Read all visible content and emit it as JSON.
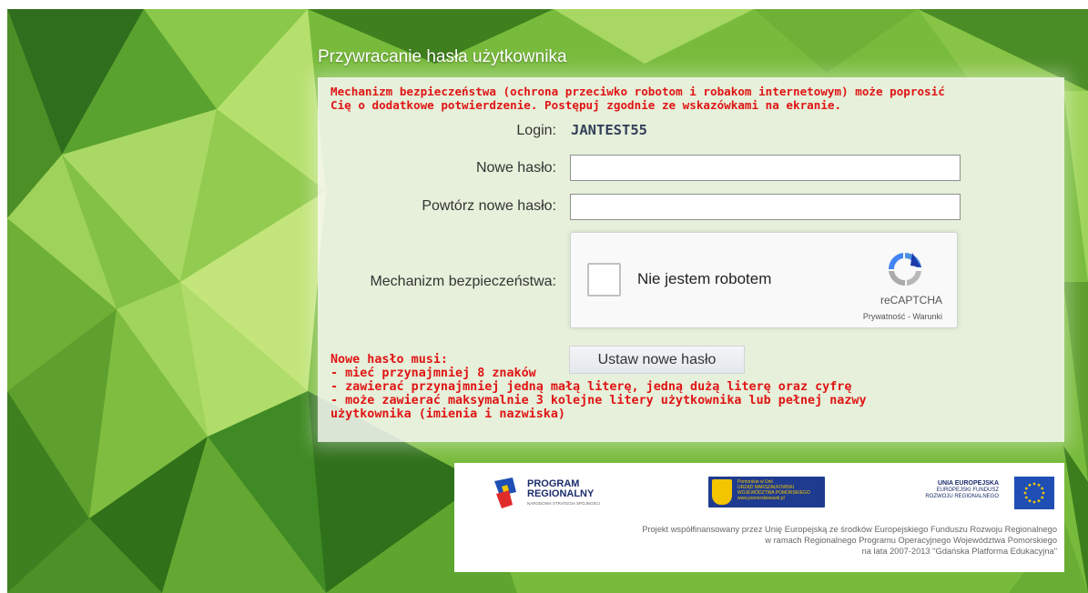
{
  "page": {
    "title": "Przywracanie hasła użytkownika",
    "warning_line1": "Mechanizm bezpieczeństwa (ochrona przeciwko robotom i robakom internetowym) może poprosić",
    "warning_line2": "Cię o dodatkowe potwierdzenie. Postępuj zgodnie ze wskazówkami na ekranie."
  },
  "form": {
    "login_label": "Login:",
    "login_value": "JANTEST55",
    "new_password_label": "Nowe hasło:",
    "new_password_value": "",
    "repeat_password_label": "Powtórz nowe hasło:",
    "repeat_password_value": "",
    "security_label": "Mechanizm bezpieczeństwa:",
    "submit_label": "Ustaw nowe hasło"
  },
  "captcha": {
    "label": "Nie jestem robotem",
    "brand": "reCAPTCHA",
    "links": "Prywatność - Warunki",
    "checked": false,
    "icon": "recaptcha-logo-icon"
  },
  "rules": {
    "heading": "Nowe hasło musi:",
    "items": [
      "- mieć przynajmniej 8 znaków",
      "- zawierać przynajmniej jedną małą literę, jedną dużą literę oraz cyfrę",
      "- może zawierać maksymalnie 3 kolejne litery użytkownika lub pełnej nazwy",
      "użytkownika (imienia i nazwiska)"
    ]
  },
  "footer": {
    "prog_line1": "PROGRAM",
    "prog_line2": "REGIONALNY",
    "prog_line3": "NARODOWA STRATEGIA SPÓJNOŚCI",
    "pom_line1": "Pomorskie w Unii",
    "pom_line2": "URZĄD MARSZAŁKOWSKI",
    "pom_line3": "WOJEWÓDZTWA POMORSKIEGO",
    "pom_line4": "www.pomorskiewunii.pl",
    "eu_line1": "UNIA EUROPEJSKA",
    "eu_line2": "EUROPEJSKI FUNDUSZ",
    "eu_line3": "ROZWOJU REGIONALNEGO",
    "text_line1": "Projekt współfinansowany przez Unię Europejską ze środków Europejskiego Funduszu Rozwoju Regionalnego",
    "text_line2": "w ramach Regionalnego Programu Operacyjnego Województwa Pomorskiego",
    "text_line3": "na lata 2007-2013 \"Gdańska Platforma Edukacyjna\""
  },
  "colors": {
    "warning": "#e01414",
    "background_green": "#6db33a",
    "eu_blue": "#1f4fb5"
  }
}
